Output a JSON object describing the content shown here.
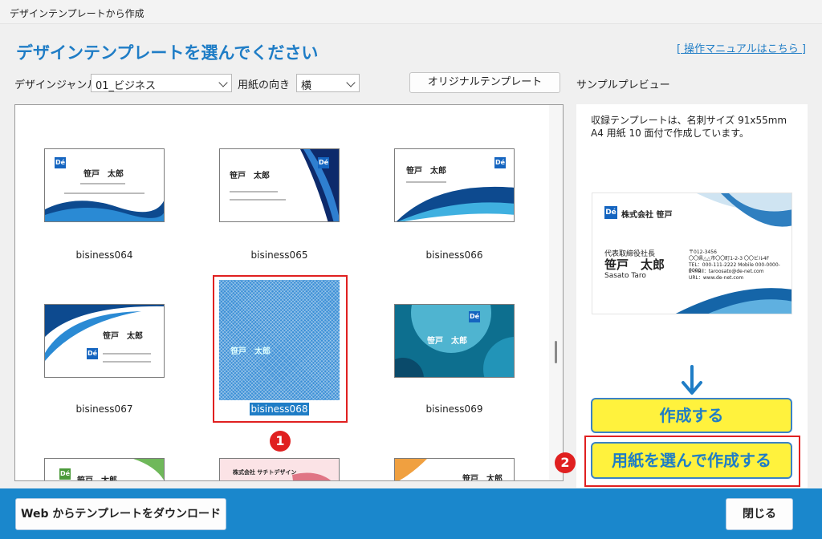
{
  "window": {
    "title": "デザインテンプレートから作成"
  },
  "heading": "デザインテンプレートを選んでください",
  "manual_link": "[ 操作マニュアルはこちら ]",
  "controls": {
    "genre_label": "デザインジャンル",
    "genre_value": "01_ビジネス",
    "orientation_label": "用紙の向き",
    "orientation_value": "横",
    "original_button": "オリジナルテンプレート",
    "preview_label": "サンプルプレビュー"
  },
  "templates": [
    {
      "caption": "bisiness064",
      "name": "笹戸　太郎"
    },
    {
      "caption": "bisiness065",
      "name": "笹戸　太郎"
    },
    {
      "caption": "bisiness066",
      "name": "笹戸　太郎"
    },
    {
      "caption": "bisiness067",
      "name": "笹戸　太郎"
    },
    {
      "caption": "bisiness068",
      "name": "笹戸　太郎"
    },
    {
      "caption": "bisiness069",
      "name": "笹戸　太郎"
    }
  ],
  "partial_row": [
    {
      "name": "笹戸　太郎"
    },
    {
      "name": "株式会社 サチトデザイン"
    },
    {
      "name": "笹戸　太郎"
    }
  ],
  "selected_index": 4,
  "preview": {
    "description": "収録テンプレートは、名刺サイズ 91x55mm A4 用紙 10 面付で作成しています。",
    "company": "株式会社 笹戸",
    "title": "代表取締役社長",
    "name": "笹戸　太郎",
    "romaji": "Sasato Taro",
    "address1": "〒012-3456",
    "address2": "〇〇県△△市〇〇町1-2-3 〇〇ビル4F",
    "phone": "TEL：000-111-2222 Mobile 000-0000-0000",
    "email": "E-mail：taroosato@de-net.com",
    "url": "URL：www.de-net.com"
  },
  "actions": {
    "create": "作成する",
    "create_with_paper": "用紙を選んで作成する"
  },
  "badges": {
    "one": "1",
    "two": "2"
  },
  "footer": {
    "download": "Web からテンプレートをダウンロード",
    "close": "閉じる"
  },
  "logo_text": "Dé",
  "colors": {
    "accent": "#1f7dc6",
    "highlight": "#fff23d",
    "alert": "#e02020",
    "footer": "#1a87cc"
  }
}
